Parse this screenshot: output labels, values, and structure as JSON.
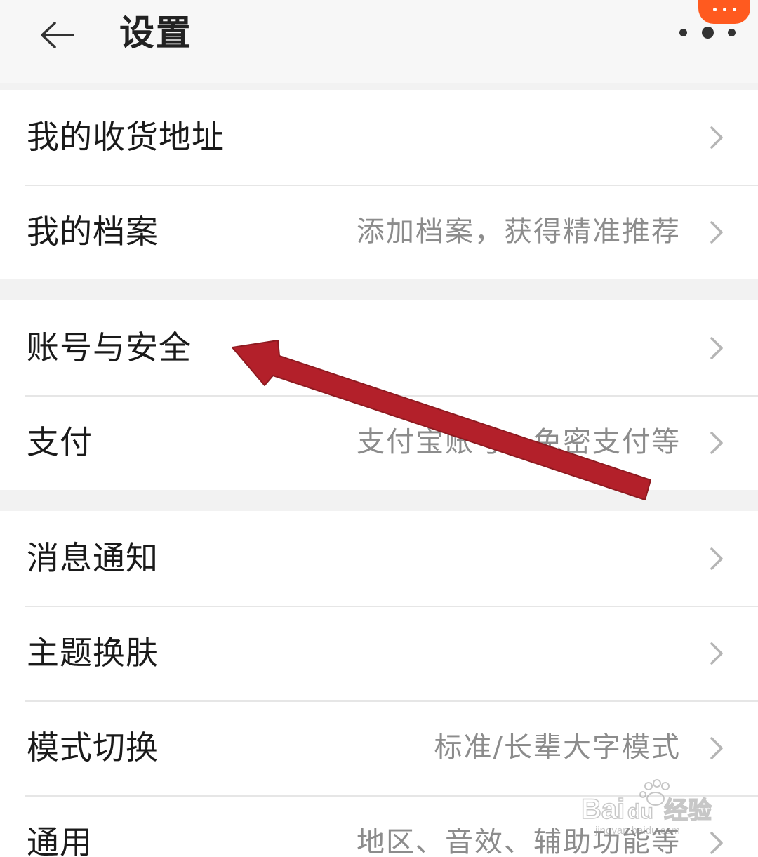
{
  "header": {
    "title": "设置",
    "back_icon": "arrow-left-icon",
    "more_icon": "more-dots-icon"
  },
  "groups": [
    {
      "items": [
        {
          "label": "我的收货地址",
          "hint": ""
        },
        {
          "label": "我的档案",
          "hint": "添加档案，获得精准推荐"
        }
      ]
    },
    {
      "items": [
        {
          "label": "账号与安全",
          "hint": ""
        },
        {
          "label": "支付",
          "hint": "支付宝账号、免密支付等"
        }
      ]
    },
    {
      "items": [
        {
          "label": "消息通知",
          "hint": ""
        },
        {
          "label": "主题换肤",
          "hint": ""
        },
        {
          "label": "模式切换",
          "hint": "标准/长辈大字模式"
        },
        {
          "label": "通用",
          "hint": "地区、音效、辅助功能等"
        }
      ]
    }
  ],
  "annotation": {
    "arrow_color": "#b3202a",
    "target": "账号与安全"
  },
  "watermark": {
    "brand": "Baidu经验",
    "url": "jingyan.baidu.com"
  },
  "colors": {
    "background": "#f2f2f2",
    "row_background": "#ffffff",
    "accent": "#ff5a1f",
    "hint_text": "#8c8c8c"
  }
}
